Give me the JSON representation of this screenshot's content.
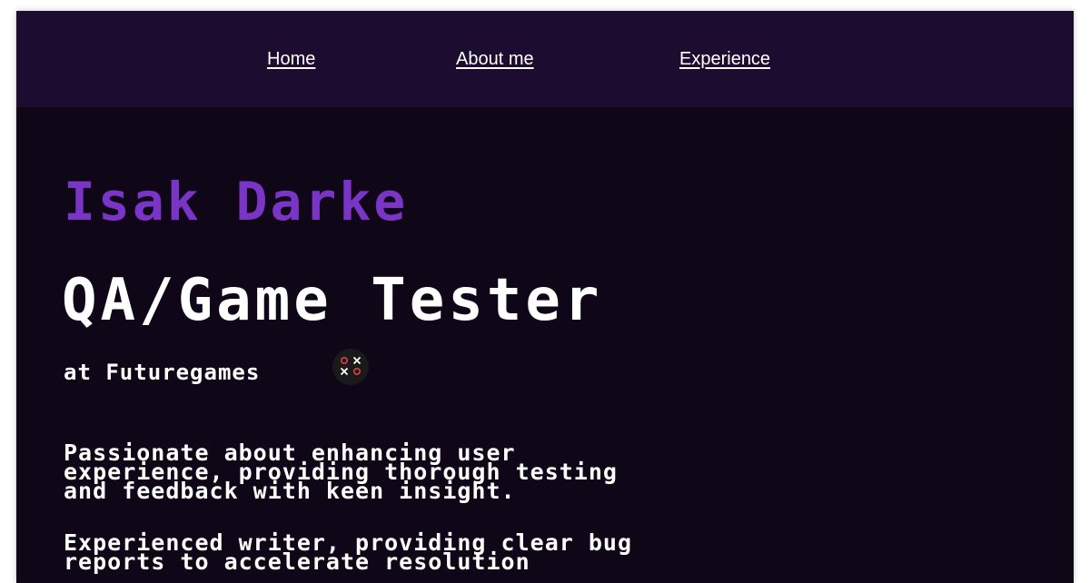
{
  "nav": {
    "links": [
      {
        "label": "Home"
      },
      {
        "label": "About me"
      },
      {
        "label": "Experience"
      }
    ]
  },
  "hero": {
    "name": "Isak Darke",
    "role": "QA/Game Tester",
    "company_line": "at Futuregames",
    "company_logo_icon": "futuregames-logo-icon"
  },
  "about": {
    "paragraph_1_lines": [
      "Passionate about enhancing user",
      "experience, providing thorough testing",
      "and feedback with keen insight."
    ],
    "paragraph_2_lines": [
      "Experienced writer, providing clear bug",
      "reports to accelerate resolution"
    ]
  },
  "colors": {
    "page_background": "#0f0718",
    "nav_background": "#1c0d30",
    "accent_purple": "#7b35c6",
    "text": "#ffffff",
    "logo_red": "#e0404a"
  }
}
